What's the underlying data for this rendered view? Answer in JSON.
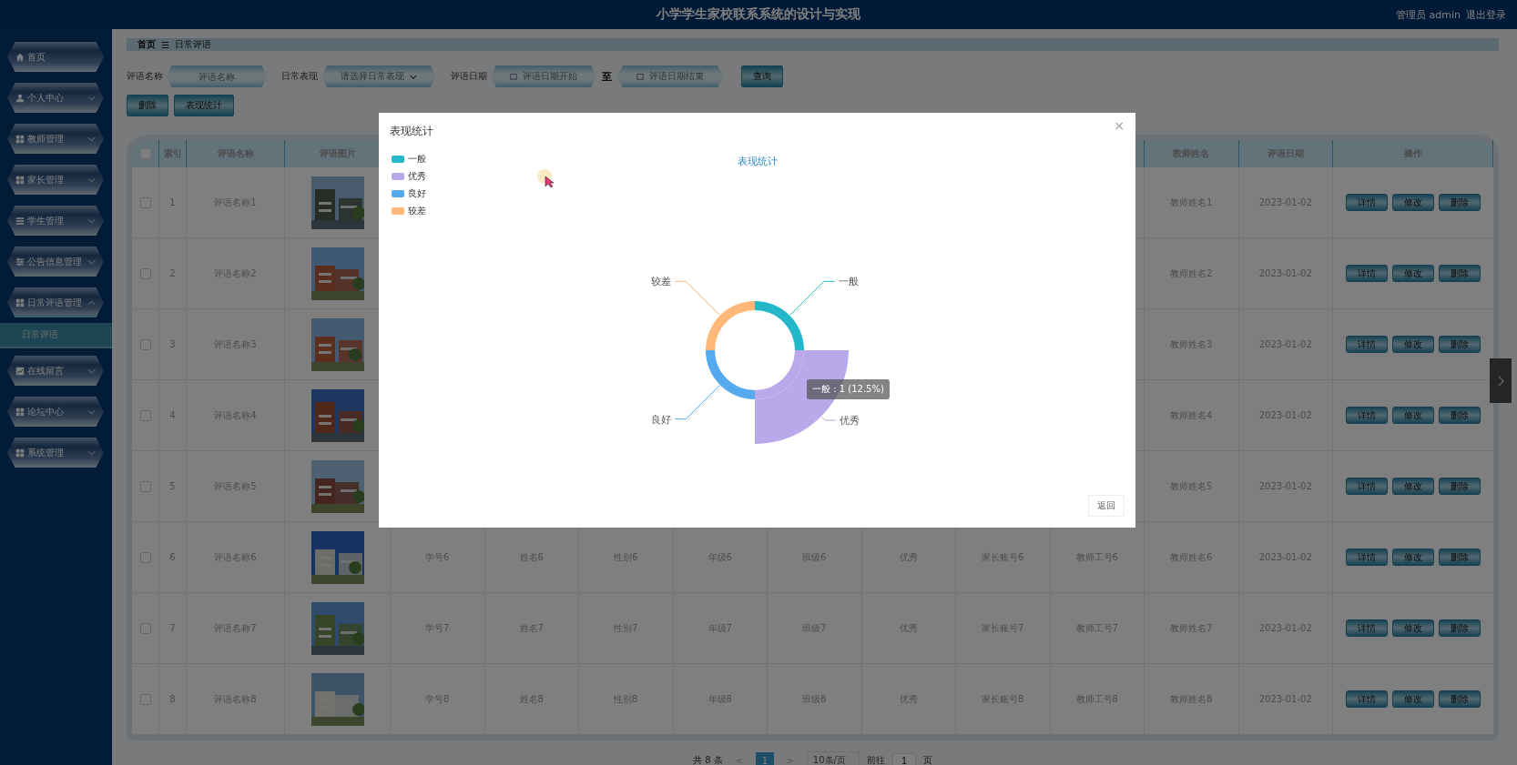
{
  "top_bar": {
    "title": "小学学生家校联系系统的设计与实现",
    "user": "管理员 admin",
    "logout": "退出登录"
  },
  "sidebar": {
    "items": [
      {
        "label": "首页",
        "expanded": false,
        "has_caret": false
      },
      {
        "label": "个人中心",
        "expanded": false,
        "has_caret": true
      },
      {
        "label": "教师管理",
        "expanded": false,
        "has_caret": true
      },
      {
        "label": "家长管理",
        "expanded": false,
        "has_caret": true
      },
      {
        "label": "学生管理",
        "expanded": false,
        "has_caret": true
      },
      {
        "label": "公告信息管理",
        "expanded": false,
        "has_caret": true
      },
      {
        "label": "日常评语管理",
        "expanded": true,
        "has_caret": true,
        "children": [
          {
            "label": "日常评语",
            "selected": true
          }
        ]
      },
      {
        "label": "在线留言",
        "expanded": false,
        "has_caret": true
      },
      {
        "label": "论坛中心",
        "expanded": false,
        "has_caret": true
      },
      {
        "label": "系统管理",
        "expanded": false,
        "has_caret": true
      }
    ]
  },
  "breadcrumb": {
    "home": "首页",
    "separator": "☰",
    "current": "日常评语"
  },
  "search": {
    "name_label": "评语名称",
    "name_placeholder": "评语名称",
    "performance_label": "日常表现",
    "performance_placeholder": "请选择日常表现",
    "date_label": "评语日期",
    "date_start_placeholder": "评语日期开始",
    "date_to": "至",
    "date_end_placeholder": "评语日期结束",
    "query_button": "查询"
  },
  "actions": [
    "删除",
    "表现统计"
  ],
  "table": {
    "header_checked": false,
    "columns": [
      {
        "header": "索引"
      },
      {
        "header": "评语名称"
      },
      {
        "header": "评语图片"
      },
      {
        "header": "教师姓名"
      },
      {
        "header": "评语日期"
      },
      {
        "header": "操作"
      }
    ],
    "rows": [
      {
        "checked": false,
        "index": "1",
        "name": "评语名称1",
        "picture": {
          "kind": "picture"
        },
        "buttons": [
          "详情",
          "修改",
          "删除"
        ],
        "teacher_name": "教师姓名1",
        "date": "2023-01-02"
      },
      {
        "checked": false,
        "index": "2",
        "name": "评语名称2",
        "picture": {
          "kind": "picture"
        },
        "buttons": [
          "详情",
          "修改",
          "删除"
        ],
        "teacher_name": "教师姓名2",
        "date": "2023-01-02"
      },
      {
        "checked": false,
        "index": "3",
        "name": "评语名称3",
        "picture": {
          "kind": "picture"
        },
        "buttons": [
          "详情",
          "修改",
          "删除"
        ],
        "teacher_name": "教师姓名3",
        "date": "2023-01-02"
      },
      {
        "checked": false,
        "index": "4",
        "name": "评语名称4",
        "picture": {
          "kind": "picture"
        },
        "buttons": [
          "详情",
          "修改",
          "删除"
        ],
        "teacher_name": "教师姓名4",
        "date": "2023-01-02"
      },
      {
        "checked": false,
        "index": "5",
        "name": "评语名称5",
        "picture": {
          "kind": "picture"
        },
        "buttons": [
          "详情",
          "修改",
          "删除"
        ],
        "teacher_name": "教师姓名5",
        "date": "2023-01-02"
      },
      {
        "checked": false,
        "index": "6",
        "name": "评语名称6",
        "picture": {
          "kind": "picture"
        },
        "cells": [
          "学号6",
          "姓名6",
          "性别6",
          "年级6",
          "班级6",
          "优秀",
          "家长账号6",
          "教师工号6"
        ],
        "buttons": [
          "详情",
          "修改",
          "删除"
        ],
        "teacher_name": "教师姓名6",
        "date": "2023-01-02"
      },
      {
        "checked": false,
        "index": "7",
        "name": "评语名称7",
        "picture": {
          "kind": "picture"
        },
        "cells": [
          "学号7",
          "姓名7",
          "性别7",
          "年级7",
          "班级7",
          "优秀",
          "家长账号7",
          "教师工号7"
        ],
        "buttons": [
          "详情",
          "修改",
          "删除"
        ],
        "teacher_name": "教师姓名7",
        "date": "2023-01-02"
      },
      {
        "checked": false,
        "index": "8",
        "name": "评语名称8",
        "picture": {
          "kind": "picture"
        },
        "cells": [
          "学号8",
          "姓名8",
          "性别8",
          "年级8",
          "班级8",
          "优秀",
          "家长账号8",
          "教师工号8"
        ],
        "buttons": [
          "详情",
          "修改",
          "删除"
        ],
        "teacher_name": "教师姓名8",
        "date": "2023-01-02"
      }
    ]
  },
  "pagination": {
    "total": "共 8 条",
    "prev": "<",
    "pages": [
      {
        "label": "1",
        "selected": true
      }
    ],
    "next": ">",
    "page_size": "10条/页",
    "goto": "前往",
    "goto_value": "1",
    "goto_unit": "页"
  },
  "modal": {
    "title": "表现统计",
    "close": "×",
    "return_button": "返回",
    "legend": [
      {
        "label": "一般",
        "color": "#23b7c9",
        "emphasized": false
      },
      {
        "label": "优秀",
        "color": "#b9a8ea",
        "emphasized": true
      },
      {
        "label": "良好",
        "color": "#55a9ef",
        "emphasized": false
      },
      {
        "label": "较差",
        "color": "#ffb878",
        "emphasized": false
      }
    ],
    "tooltip": "一般 : 1 (12.5%)",
    "chart_data": {
      "type": "donut",
      "title": "表现统计",
      "categories": [
        "一般",
        "优秀",
        "良好",
        "较差"
      ],
      "series": [
        {
          "values": [
            25,
            25,
            25,
            25
          ]
        }
      ]
    }
  }
}
